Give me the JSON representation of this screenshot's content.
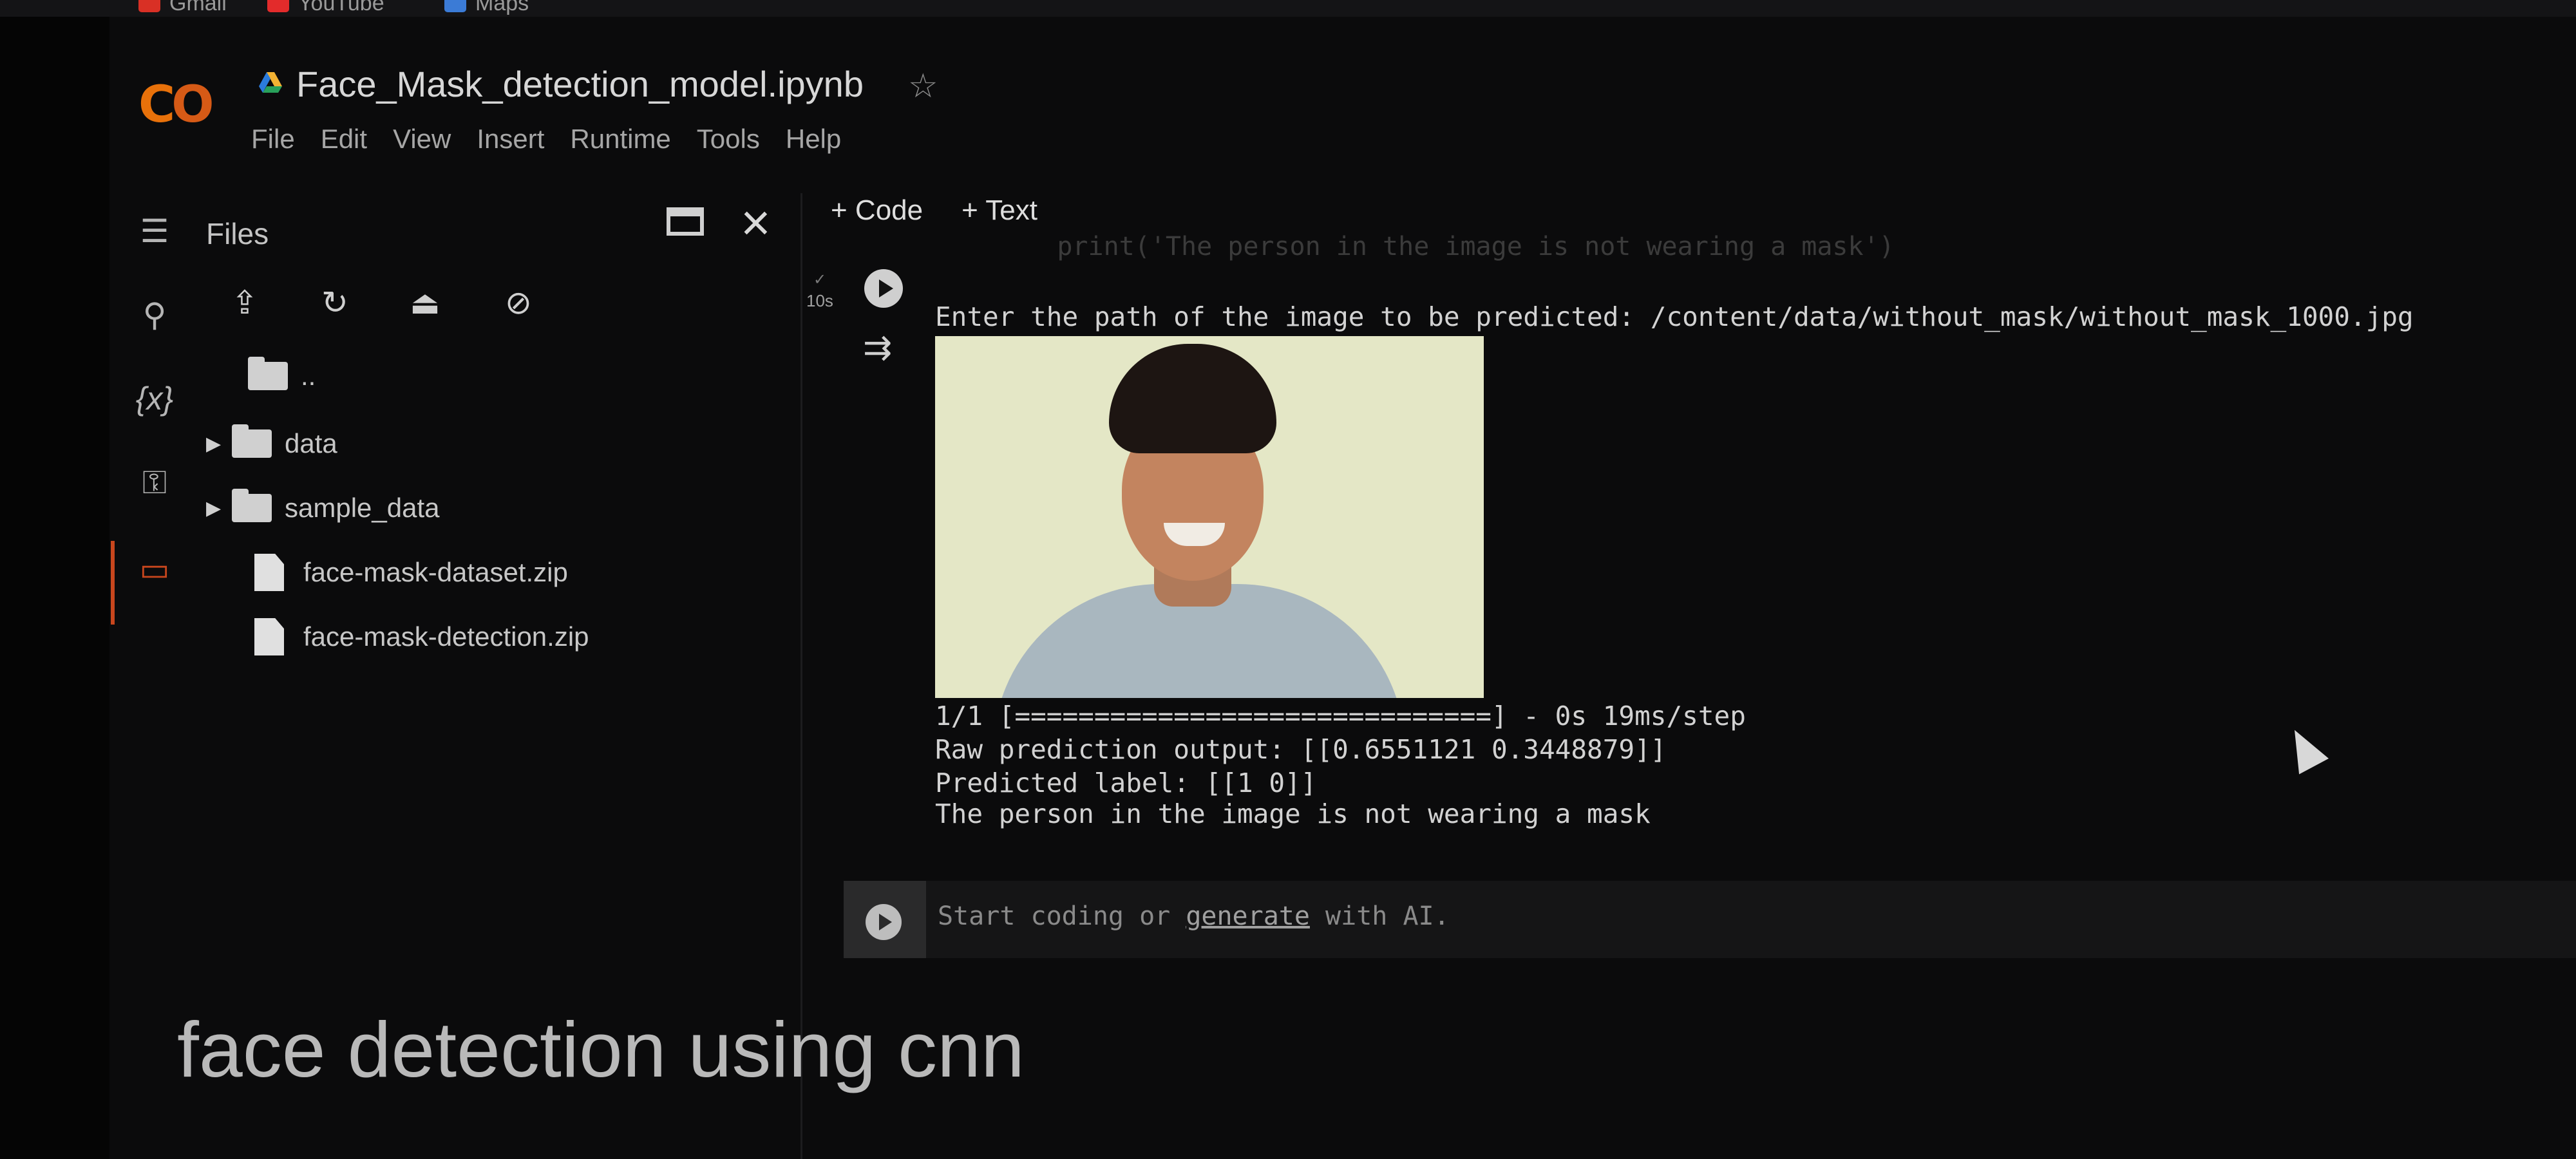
{
  "bookmarks": [
    {
      "label": "Gmail",
      "icon": "gmail-icon",
      "color": "#d93025"
    },
    {
      "label": "YouTube",
      "icon": "youtube-icon",
      "color": "#e32b2b"
    },
    {
      "label": "Maps",
      "icon": "maps-icon",
      "color": "#3b7bd6"
    }
  ],
  "app": {
    "logo_left": "C",
    "logo_right": "O"
  },
  "notebook": {
    "title": "Face_Mask_detection_model.ipynb"
  },
  "menu": [
    "File",
    "Edit",
    "View",
    "Insert",
    "Runtime",
    "Tools",
    "Help"
  ],
  "sidebar": {
    "title": "Files",
    "rail_icons": [
      "menu-icon",
      "search-icon",
      "variables-icon",
      "key-icon",
      "folder-icon"
    ],
    "toolbar_icons": [
      "upload-file-icon",
      "refresh-icon",
      "mount-drive-icon",
      "hide-files-icon"
    ],
    "tree": [
      {
        "type": "folder",
        "name": "..",
        "expandable": false
      },
      {
        "type": "folder",
        "name": "data",
        "expandable": true
      },
      {
        "type": "folder",
        "name": "sample_data",
        "expandable": true
      },
      {
        "type": "file",
        "name": "face-mask-dataset.zip"
      },
      {
        "type": "file",
        "name": "face-mask-detection.zip"
      }
    ]
  },
  "toolbar": {
    "add_code": "+ Code",
    "add_text": "+ Text"
  },
  "cell": {
    "exec_time": "10s",
    "partial_code": "    print('The person in the image is not wearing a mask')",
    "output": {
      "prompt": "Enter the path of the image to be predicted: /content/data/without_mask/without_mask_1000.jpg",
      "progress": "1/1 [==============================] - 0s 19ms/step",
      "raw": "Raw prediction output: [[0.6551121 0.3448879]]",
      "label": "Predicted label: [[1 0]]",
      "result": "The person in the image is not wearing a mask"
    }
  },
  "new_cell": {
    "prefix": "Start coding or ",
    "link": "generate",
    "suffix": " with AI."
  },
  "markdown": {
    "heading": "face detection using cnn"
  },
  "colors": {
    "accent": "#e8710a",
    "background": "#0b0b0c"
  }
}
